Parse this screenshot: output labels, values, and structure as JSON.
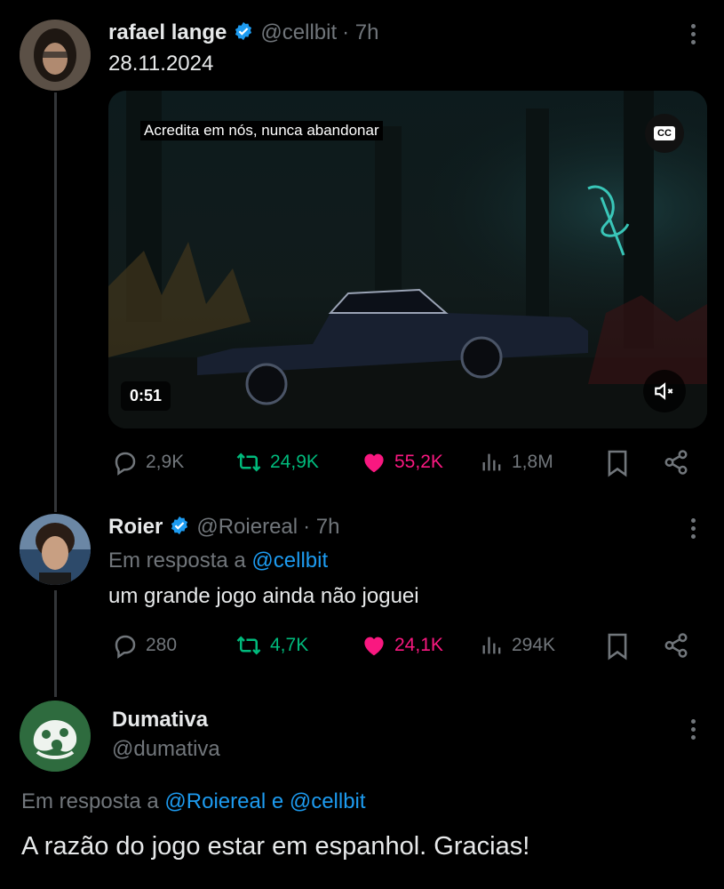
{
  "tweet": {
    "author_name": "rafael lange",
    "handle": "@cellbit",
    "time": "· 7h",
    "text": "28.11.2024",
    "media": {
      "caption": "Acredita em nós, nunca abandonar",
      "cc_label": "CC",
      "duration": "0:51"
    },
    "stats": {
      "replies": "2,9K",
      "reposts": "24,9K",
      "likes": "55,2K",
      "views": "1,8M"
    }
  },
  "reply1": {
    "author_name": "Roier",
    "handle": "@Roiereal",
    "time": "· 7h",
    "reply_prefix": "Em resposta a",
    "reply_to": "@cellbit",
    "text": "um grande jogo ainda não joguei",
    "stats": {
      "replies": "280",
      "reposts": "4,7K",
      "likes": "24,1K",
      "views": "294K"
    }
  },
  "reply2": {
    "author_name": "Dumativa",
    "handle": "@dumativa",
    "reply_prefix": "Em resposta a",
    "reply_to": "@Roiereal e @cellbit",
    "text": "A razão do jogo estar em espanhol. Gracias!"
  },
  "colors": {
    "accent": "#1d9bf0",
    "repost": "#00ba7c",
    "like": "#f91880",
    "muted": "#71767b"
  }
}
